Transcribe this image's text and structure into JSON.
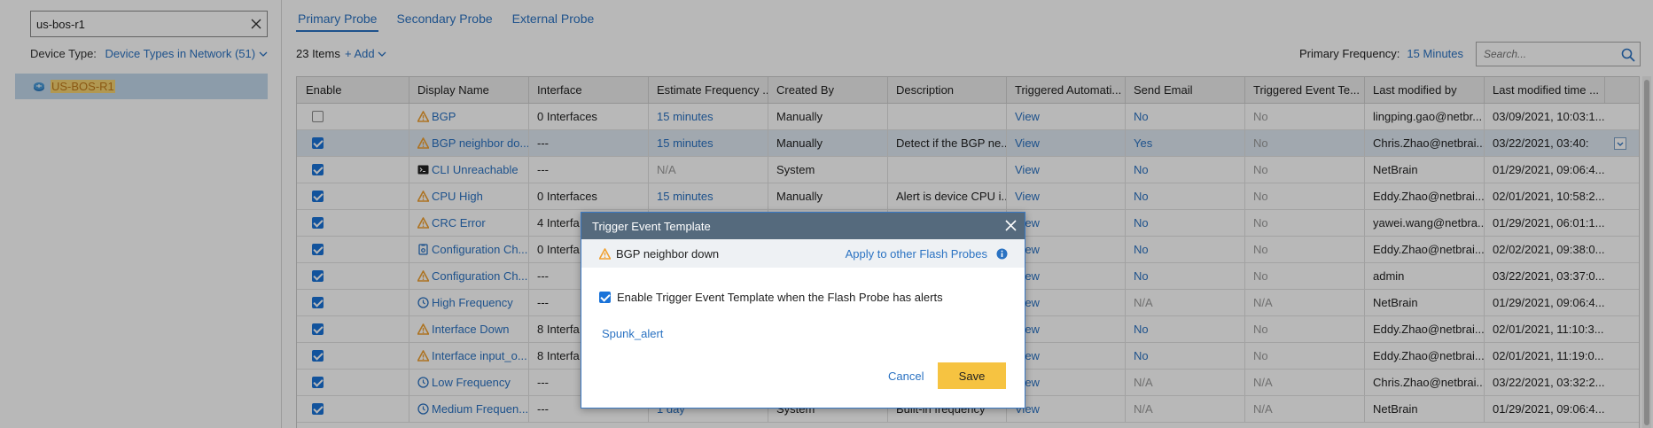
{
  "left": {
    "search_value": "us-bos-r1",
    "device_type_label": "Device Type:",
    "device_type_value": "Device Types in Network (51)",
    "device_name": "US-BOS-R1"
  },
  "tabs": [
    "Primary Probe",
    "Secondary Probe",
    "External Probe"
  ],
  "toolbar": {
    "items_count": "23 Items",
    "add_label": "+ Add",
    "freq_label": "Primary Frequency:",
    "freq_value": "15 Minutes",
    "search_placeholder": "Search..."
  },
  "table": {
    "headers": [
      "Enable",
      "Display Name",
      "Interface",
      "Estimate Frequency ...",
      "Created By",
      "Description",
      "Triggered Automati...",
      "Send Email",
      "Triggered Event Te...",
      "Last modified by",
      "Last modified time ..."
    ],
    "rows": [
      {
        "checked": false,
        "icon": "warning-icon",
        "name": "BGP",
        "interface": "0 Interfaces",
        "freq": "15 minutes",
        "freq_gray": false,
        "created": "Manually",
        "desc": "",
        "auto": "View",
        "email": "No",
        "email_gray": false,
        "event": "No",
        "by": "lingping.gao@netbr...",
        "time": "03/09/2021, 10:03:1..."
      },
      {
        "checked": true,
        "icon": "warning-icon",
        "name": "BGP neighbor do...",
        "interface": "---",
        "freq": "15 minutes",
        "freq_gray": false,
        "created": "Manually",
        "desc": "Detect if the BGP ne...",
        "auto": "View",
        "email": "Yes",
        "email_gray": false,
        "event": "No",
        "by": "Chris.Zhao@netbrai...",
        "time": "03/22/2021, 03:40:",
        "selected": true
      },
      {
        "checked": true,
        "icon": "cli-icon",
        "name": "CLI Unreachable",
        "interface": "---",
        "freq": "N/A",
        "freq_gray": true,
        "created": "System",
        "desc": "",
        "auto": "View",
        "email": "No",
        "email_gray": false,
        "event": "No",
        "by": "NetBrain",
        "time": "01/29/2021, 09:06:4..."
      },
      {
        "checked": true,
        "icon": "warning-icon",
        "name": "CPU High",
        "interface": "0 Interfaces",
        "freq": "15 minutes",
        "freq_gray": false,
        "created": "Manually",
        "desc": "Alert is device CPU i...",
        "auto": "View",
        "email": "No",
        "email_gray": false,
        "event": "No",
        "by": "Eddy.Zhao@netbrai...",
        "time": "02/01/2021, 10:58:2..."
      },
      {
        "checked": true,
        "icon": "warning-icon",
        "name": "CRC Error",
        "interface": "4 Interfa",
        "freq": "",
        "freq_gray": false,
        "created": "",
        "desc": "",
        "auto": "View",
        "email": "No",
        "email_gray": false,
        "event": "No",
        "by": "yawei.wang@netbra...",
        "time": "01/29/2021, 06:01:1..."
      },
      {
        "checked": true,
        "icon": "config-icon",
        "name": "Configuration Ch...",
        "interface": "0 Interfa",
        "freq": "",
        "freq_gray": false,
        "created": "",
        "desc": "",
        "auto": "View",
        "email": "No",
        "email_gray": false,
        "event": "No",
        "by": "Eddy.Zhao@netbrai...",
        "time": "02/02/2021, 09:38:0..."
      },
      {
        "checked": true,
        "icon": "warning-icon",
        "name": "Configuration Ch...",
        "interface": "---",
        "freq": "",
        "freq_gray": false,
        "created": "",
        "desc": "",
        "auto": "View",
        "email": "No",
        "email_gray": false,
        "event": "No",
        "by": "admin",
        "time": "03/22/2021, 03:37:0..."
      },
      {
        "checked": true,
        "icon": "clock-icon",
        "name": "High Frequency",
        "interface": "---",
        "freq": "",
        "freq_gray": false,
        "created": "",
        "desc": "",
        "auto": "View",
        "email": "N/A",
        "email_gray": true,
        "event": "N/A",
        "by": "NetBrain",
        "time": "01/29/2021, 09:06:4..."
      },
      {
        "checked": true,
        "icon": "warning-icon",
        "name": "Interface Down",
        "interface": "8 Interfa",
        "freq": "",
        "freq_gray": false,
        "created": "",
        "desc": "",
        "auto": "View",
        "email": "No",
        "email_gray": false,
        "event": "No",
        "by": "Eddy.Zhao@netbrai...",
        "time": "02/01/2021, 11:10:3..."
      },
      {
        "checked": true,
        "icon": "warning-icon",
        "name": "Interface input_o...",
        "interface": "8 Interfa",
        "freq": "",
        "freq_gray": false,
        "created": "",
        "desc": "",
        "auto": "View",
        "email": "No",
        "email_gray": false,
        "event": "No",
        "by": "Eddy.Zhao@netbrai...",
        "time": "02/01/2021, 11:19:0..."
      },
      {
        "checked": true,
        "icon": "clock-icon",
        "name": "Low Frequency",
        "interface": "---",
        "freq": "",
        "freq_gray": false,
        "created": "",
        "desc": "",
        "auto": "View",
        "email": "N/A",
        "email_gray": true,
        "event": "N/A",
        "by": "Chris.Zhao@netbrai...",
        "time": "03/22/2021, 03:32:2..."
      },
      {
        "checked": true,
        "icon": "clock-icon",
        "name": "Medium Frequen...",
        "interface": "---",
        "freq": "1 day",
        "freq_gray": false,
        "created": "System",
        "desc": "Built-in frequency",
        "auto": "View",
        "email": "N/A",
        "email_gray": true,
        "event": "N/A",
        "by": "NetBrain",
        "time": "01/29/2021, 09:06:4..."
      }
    ]
  },
  "modal": {
    "header": "Trigger Event Template",
    "probe_name": "BGP neighbor down",
    "apply_label": "Apply to other Flash Probes",
    "enable_label": "Enable Trigger Event Template when the Flash Probe has alerts",
    "enable_checked": true,
    "template_link": "Spunk_alert",
    "cancel_label": "Cancel",
    "save_label": "Save"
  },
  "colors": {
    "accent": "#2a72c2",
    "warning": "#f0a030",
    "modal_header": "#556a7d",
    "save_button": "#f6c341",
    "selection": "#c3d8ec"
  }
}
